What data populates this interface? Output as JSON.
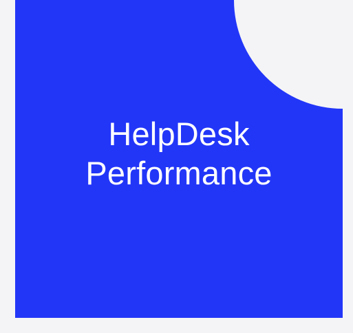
{
  "tile": {
    "title_line_1": "HelpDesk",
    "title_line_2": "Performance"
  },
  "colors": {
    "tile_background": "#2236f8",
    "page_background": "#f4f4f6",
    "title_text": "#ffffff"
  }
}
